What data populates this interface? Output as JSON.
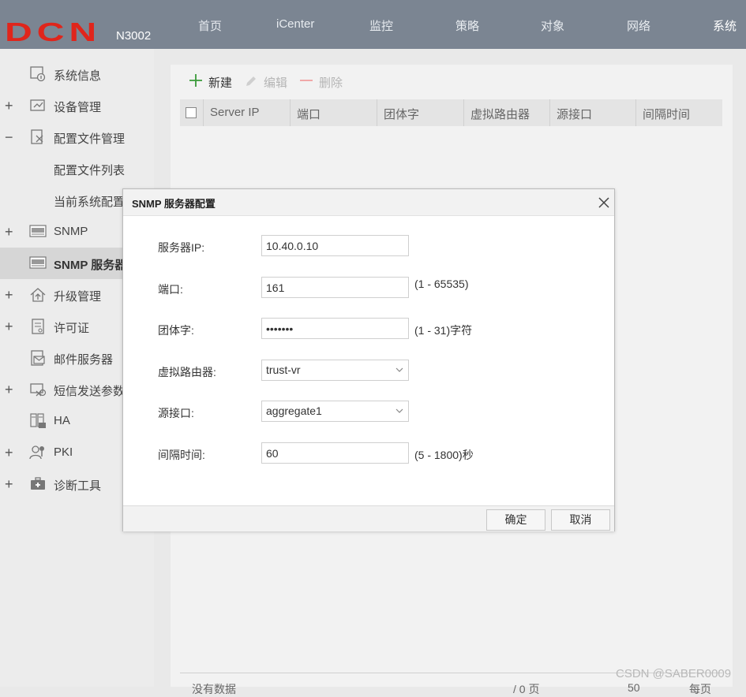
{
  "header": {
    "logo_text": "DCN",
    "model": "N3002",
    "nav": [
      "首页",
      "iCenter",
      "监控",
      "策略",
      "对象",
      "网络",
      "系统"
    ],
    "active_nav": "系统"
  },
  "sidebar": {
    "items": [
      {
        "label": "系统信息",
        "toggle": "",
        "icon": "system-info-icon"
      },
      {
        "label": "设备管理",
        "toggle": "+",
        "icon": "device-management-icon"
      },
      {
        "label": "配置文件管理",
        "toggle": "−",
        "icon": "config-file-icon"
      },
      {
        "label": "配置文件列表",
        "toggle": "",
        "icon": ""
      },
      {
        "label": "当前系统配置",
        "toggle": "",
        "icon": ""
      },
      {
        "label": "SNMP",
        "toggle": "+",
        "icon": "snmp-icon"
      },
      {
        "label": "SNMP 服务器",
        "toggle": "",
        "icon": "snmp-server-icon"
      },
      {
        "label": "升级管理",
        "toggle": "+",
        "icon": "upgrade-icon"
      },
      {
        "label": "许可证",
        "toggle": "+",
        "icon": "license-icon"
      },
      {
        "label": "邮件服务器",
        "toggle": "",
        "icon": "mail-server-icon"
      },
      {
        "label": "短信发送参数",
        "toggle": "+",
        "icon": "sms-icon"
      },
      {
        "label": "HA",
        "toggle": "",
        "icon": "ha-icon"
      },
      {
        "label": "PKI",
        "toggle": "+",
        "icon": "pki-icon"
      },
      {
        "label": "诊断工具",
        "toggle": "+",
        "icon": "diagnostic-icon"
      }
    ]
  },
  "toolbar": {
    "new_label": "新建",
    "edit_label": "编辑",
    "delete_label": "删除"
  },
  "table": {
    "columns": [
      "Server IP",
      "端口",
      "团体字",
      "虚拟路由器",
      "源接口",
      "间隔时间"
    ]
  },
  "footer": {
    "no_data": "没有数据",
    "page_text": "/ 0 页",
    "page_size": "50",
    "per_page": "每页"
  },
  "modal": {
    "title": "SNMP 服务器配置",
    "fields": {
      "server_ip": {
        "label": "服务器IP:",
        "value": "10.40.0.10"
      },
      "port": {
        "label": "端口:",
        "value": "161",
        "hint": "(1 - 65535)"
      },
      "community": {
        "label": "团体字:",
        "value": "•••••••",
        "hint": "(1 - 31)字符"
      },
      "vrouter": {
        "label": "虚拟路由器:",
        "value": "trust-vr"
      },
      "source_interface": {
        "label": "源接口:",
        "value": "aggregate1"
      },
      "interval": {
        "label": "间隔时间:",
        "value": "60",
        "hint": "(5 - 1800)秒"
      }
    },
    "ok_label": "确定",
    "cancel_label": "取消"
  },
  "watermark": "CSDN @SABER0009",
  "colors": {
    "header_bg": "#7b8592",
    "logo_red": "#e0251b",
    "sidebar_bg": "#ececec",
    "selected_bg": "#d6d6d6",
    "add_green": "#3a9a3a",
    "delete_red": "#f0a0a0"
  }
}
